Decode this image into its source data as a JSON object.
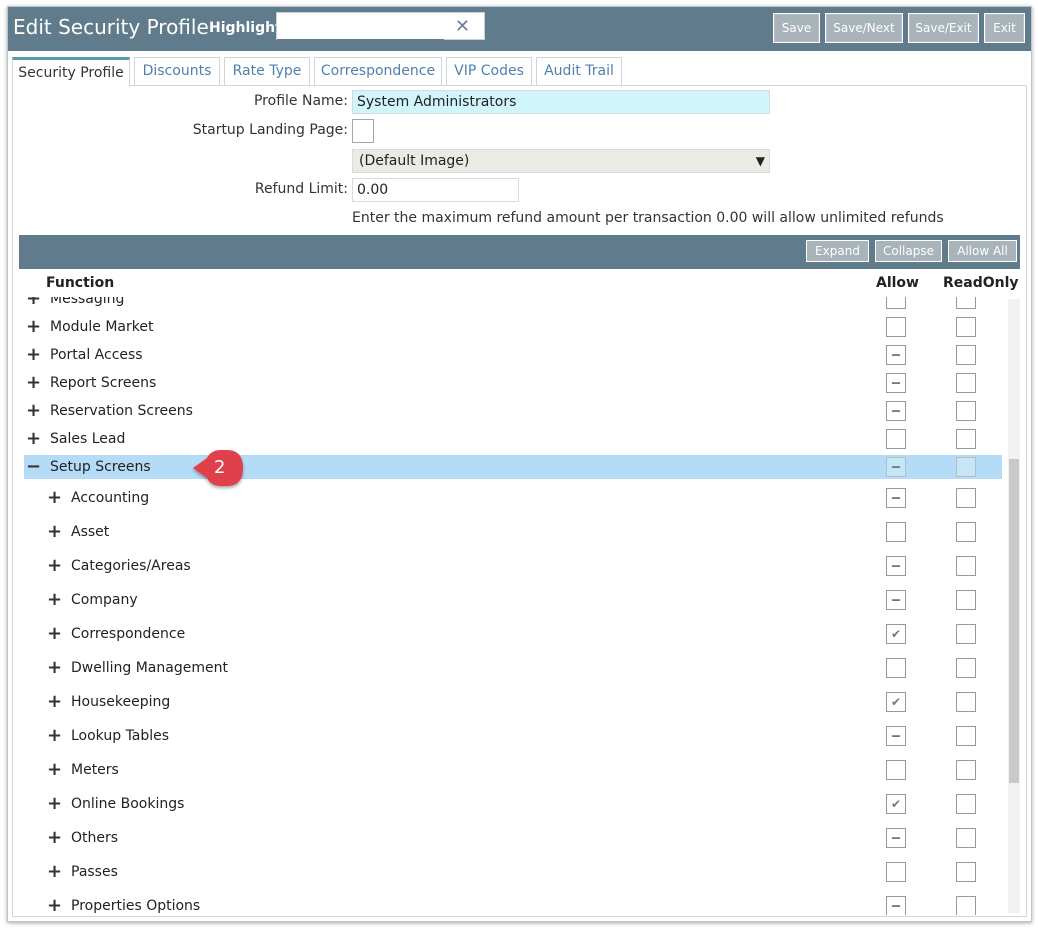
{
  "header": {
    "title": "Edit Security Profile",
    "highlight_label": "Highlight:",
    "highlight_value": "",
    "clear_glyph": "✕",
    "buttons": [
      "Save",
      "Save/Next",
      "Save/Exit",
      "Exit"
    ]
  },
  "tabs": [
    "Security Profile",
    "Discounts",
    "Rate Type",
    "Correspondence",
    "VIP Codes",
    "Audit Trail"
  ],
  "active_tab": "Security Profile",
  "form": {
    "profile_name_label": "Profile Name:",
    "profile_name_value": "System Administrators",
    "startup_label": "Startup Landing Page:",
    "image_select_value": "(Default Image)",
    "refund_label": "Refund Limit:",
    "refund_value": "0.00",
    "refund_hint": "Enter the maximum refund amount per transaction 0.00 will allow unlimited refunds"
  },
  "toolbar": {
    "expand": "Expand",
    "collapse": "Collapse",
    "allow_all": "Allow All"
  },
  "grid": {
    "col_function": "Function",
    "col_allow": "Allow",
    "col_readonly": "ReadOnly",
    "rows": [
      {
        "label": "Messaging",
        "level": 0,
        "expanded": false,
        "allow": "empty",
        "readonly": "empty",
        "partial": true
      },
      {
        "label": "Module Market",
        "level": 0,
        "expanded": false,
        "allow": "empty",
        "readonly": "empty"
      },
      {
        "label": "Portal Access",
        "level": 0,
        "expanded": false,
        "allow": "partial",
        "readonly": "empty"
      },
      {
        "label": "Report Screens",
        "level": 0,
        "expanded": false,
        "allow": "partial",
        "readonly": "empty"
      },
      {
        "label": "Reservation Screens",
        "level": 0,
        "expanded": false,
        "allow": "partial",
        "readonly": "empty"
      },
      {
        "label": "Sales Lead",
        "level": 0,
        "expanded": false,
        "allow": "empty",
        "readonly": "empty"
      },
      {
        "label": "Setup Screens",
        "level": 0,
        "expanded": true,
        "allow": "partial",
        "readonly": "empty",
        "selected": true
      },
      {
        "label": "Accounting",
        "level": 1,
        "expanded": false,
        "allow": "partial",
        "readonly": "empty"
      },
      {
        "label": "Asset",
        "level": 1,
        "expanded": false,
        "allow": "empty",
        "readonly": "empty"
      },
      {
        "label": "Categories/Areas",
        "level": 1,
        "expanded": false,
        "allow": "partial",
        "readonly": "empty"
      },
      {
        "label": "Company",
        "level": 1,
        "expanded": false,
        "allow": "partial",
        "readonly": "empty"
      },
      {
        "label": "Correspondence",
        "level": 1,
        "expanded": false,
        "allow": "checked",
        "readonly": "empty"
      },
      {
        "label": "Dwelling Management",
        "level": 1,
        "expanded": false,
        "allow": "empty",
        "readonly": "empty"
      },
      {
        "label": "Housekeeping",
        "level": 1,
        "expanded": false,
        "allow": "checked",
        "readonly": "empty"
      },
      {
        "label": "Lookup Tables",
        "level": 1,
        "expanded": false,
        "allow": "partial",
        "readonly": "empty"
      },
      {
        "label": "Meters",
        "level": 1,
        "expanded": false,
        "allow": "empty",
        "readonly": "empty"
      },
      {
        "label": "Online Bookings",
        "level": 1,
        "expanded": false,
        "allow": "checked",
        "readonly": "empty"
      },
      {
        "label": "Others",
        "level": 1,
        "expanded": false,
        "allow": "partial",
        "readonly": "empty"
      },
      {
        "label": "Passes",
        "level": 1,
        "expanded": false,
        "allow": "empty",
        "readonly": "empty"
      },
      {
        "label": "Properties Options",
        "level": 1,
        "expanded": false,
        "allow": "partial",
        "readonly": "empty"
      }
    ]
  },
  "annotation": {
    "step_number": "2",
    "color": "#e0414b"
  },
  "colors": {
    "header": "#5f7b8c",
    "selected_row": "#b4dcf6",
    "profile_input": "#d0f6fb",
    "select_bg": "#ebeae5"
  }
}
